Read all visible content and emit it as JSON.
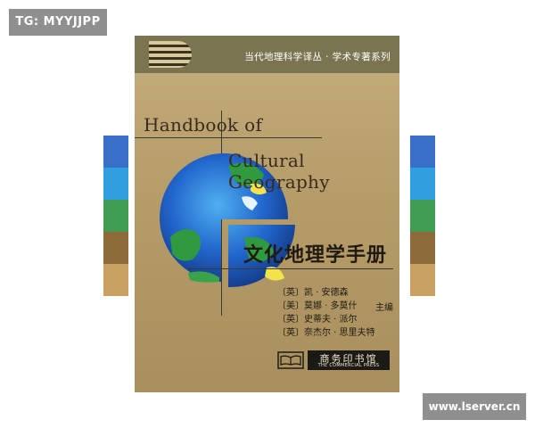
{
  "watermarks": {
    "top_left": "TG: MYYJJPP",
    "bottom_right": "www.lserver.cn"
  },
  "cover": {
    "series": "当代地理科学译丛 · 学术专著系列",
    "english_title_line1": "Handbook of",
    "english_title_line2": "Cultural Geography",
    "chinese_title": "文化地理学手册",
    "authors": [
      "〔英〕凯 · 安德森",
      "〔美〕莫娜 · 多莫什",
      "〔英〕史蒂夫 · 派尔",
      "〔英〕奈杰尔 · 思里夫特"
    ],
    "editor_role": "主编",
    "publisher_name": "商务印书馆",
    "publisher_english": "THE COMMERCIAL PRESS"
  },
  "colors": {
    "cover_gold": "#b59c69",
    "band": "#7a7550",
    "strip_colors": [
      "#3a6fc7",
      "#2f9fe0",
      "#3f9c52",
      "#8d6b3a",
      "#c8a062"
    ]
  }
}
